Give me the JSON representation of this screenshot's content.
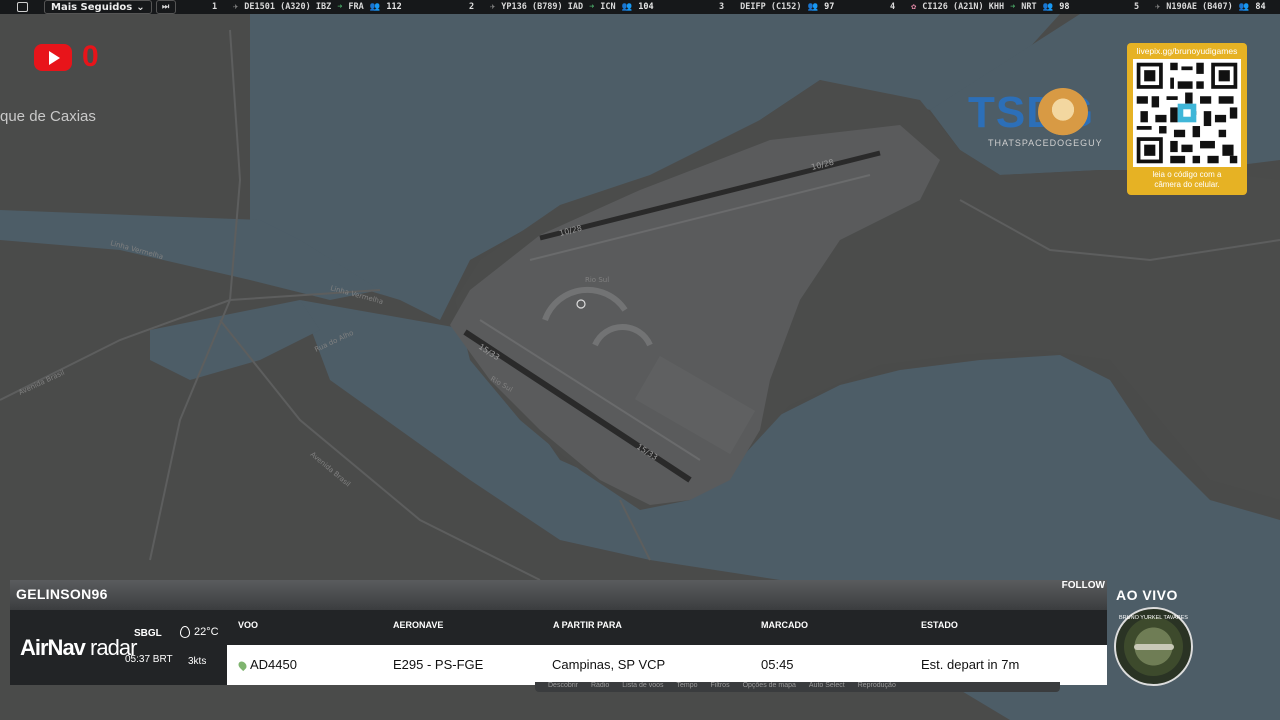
{
  "topbar": {
    "following_label": "Mais Seguidos",
    "tickers": [
      {
        "rank": "1",
        "flight": "DE1501 (A320) IBZ",
        "dest": "FRA",
        "alt": "112"
      },
      {
        "rank": "2",
        "flight": "YP136 (B789) IAD",
        "dest": "ICN",
        "alt": "104"
      },
      {
        "rank": "3",
        "flight": "DEIFP (C152)",
        "dest": "",
        "alt": "97"
      },
      {
        "rank": "4",
        "flight": "CI126 (A21N) KHH",
        "dest": "NRT",
        "alt": "98"
      },
      {
        "rank": "5",
        "flight": "N190AE (B407)",
        "dest": "",
        "alt": "84"
      }
    ]
  },
  "colors": {
    "brand_red": "#e8141a",
    "tsdg_blue": "#2c6fb8",
    "qr_gold": "#e6b224",
    "water": "#4d5d67",
    "land": "#4a4b4a"
  },
  "map": {
    "place_label": "que de Caxias",
    "runway_labels": [
      "10/28",
      "10/28",
      "15/33",
      "15/33"
    ],
    "street_labels": [
      "Linha Vermelha",
      "Linha Vermelha",
      "Rua do Alho",
      "Avenida Brasil",
      "Avenida Brasil",
      "Rio Sul",
      "Rio Sul"
    ]
  },
  "overlays": {
    "youtube_count": "0",
    "tsdg_logo": "TSDG",
    "tsdg_sub": "THATSPACEDOGEGUY",
    "qr_url": "livepix.gg/brunoyudigames",
    "qr_note_1": "leia o código com a",
    "qr_note_2": "câmera do celular."
  },
  "panel": {
    "username": "GELINSON96",
    "follow_label": "FOLLOW",
    "brand_a": "AirNav",
    "brand_b": "radar",
    "icao": "SBGL",
    "local_time": "05:37 BRT",
    "temperature": "22°C",
    "wind": "3kts",
    "headers": {
      "flight": "VOO",
      "aircraft": "AERONAVE",
      "route": "A PARTIR PARA",
      "scheduled": "MARCADO",
      "status": "ESTADO"
    },
    "row": {
      "flight": "AD4450",
      "aircraft": "E295 - PS-FGE",
      "route": "Campinas, SP VCP",
      "scheduled": "05:45",
      "status": "Est. depart in 7m"
    },
    "menu": [
      "Descobrir",
      "Rádio",
      "Lista de voos",
      "Tempo",
      "Filtros",
      "Opções de mapa",
      "Auto Select",
      "Reprodução"
    ]
  },
  "live": {
    "label": "AO VIVO",
    "badge_text": "BRUNO YURKEL TAVARES"
  }
}
